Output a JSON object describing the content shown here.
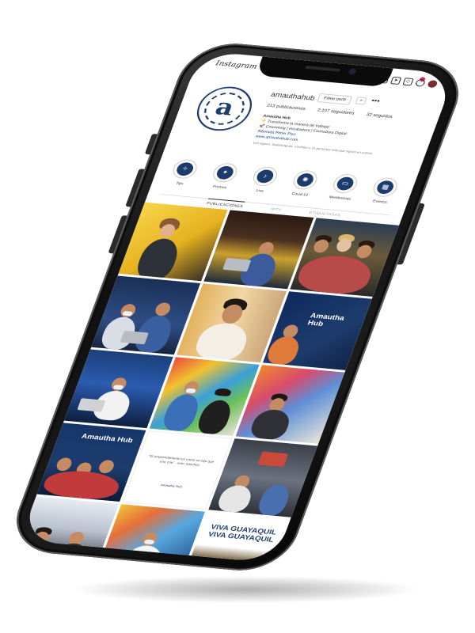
{
  "app": {
    "name": "Instagram"
  },
  "profile": {
    "logo_glyph": "a",
    "username": "amauthahub",
    "edit_label": "Editar perfil",
    "user_icon": "person-add-icon",
    "more": "•••",
    "posts": "213 publicaciones",
    "followers": "2,107 seguidores",
    "following": "32 seguidos",
    "bio_name": "Amautha Hub",
    "bio_line1": "⚡ Transforma la manera de trabajar",
    "bio_line2": "🚀 Coworking | Incubadora | Formadora Digital",
    "bio_link1": "Alborada Pimer Piso",
    "bio_link2": "www.amauthahub.com",
    "followed_by": "Les siguen: skatelenguas, rumihipo y 15 personas más que sigues en común"
  },
  "highlights": [
    {
      "label": "Tips",
      "icon": "lightbulb-icon",
      "glyph": "✧"
    },
    {
      "label": "Promos",
      "icon": "megaphone-icon",
      "glyph": "✦"
    },
    {
      "label": "Live",
      "icon": "microphone-icon",
      "glyph": "♪"
    },
    {
      "label": "Covid-19",
      "icon": "virus-icon",
      "glyph": "✺"
    },
    {
      "label": "Membresías",
      "icon": "card-icon",
      "glyph": "▭"
    },
    {
      "label": "Eventos",
      "icon": "calendar-icon",
      "glyph": "▦"
    }
  ],
  "tabs": {
    "posts": "PUBLICACIONES",
    "igtv": "IGTV",
    "tagged": "ETIQUETADAS"
  },
  "posts": [
    {
      "kind": "yellow-portrait",
      "caption": ""
    },
    {
      "kind": "cowork-dark",
      "caption": ""
    },
    {
      "kind": "three-women",
      "caption": ""
    },
    {
      "kind": "office-blue",
      "caption": ""
    },
    {
      "kind": "man-portrait",
      "caption": ""
    },
    {
      "kind": "brand-wall",
      "caption": "Amautha Hub"
    },
    {
      "kind": "masked-laptop",
      "caption": ""
    },
    {
      "kind": "colorful-wall",
      "caption": ""
    },
    {
      "kind": "show-work",
      "caption": ""
    },
    {
      "kind": "team-blue",
      "caption": "Amautha Hub"
    },
    {
      "kind": "quote-card",
      "caption": "\"El emprendimiento es como un hijo que uno cría\" - Ivan Sanchez"
    },
    {
      "kind": "meeting-room",
      "caption": ""
    },
    {
      "kind": "workshop",
      "caption": ""
    },
    {
      "kind": "laptop-man",
      "caption": ""
    },
    {
      "kind": "viva-guayaquil",
      "caption": "VIVA GUAYAQUIL VIVA GUAYAQUIL"
    }
  ],
  "quote_brand": "Amautha Hub",
  "colors": {
    "brand_blue": "#1d3c6e",
    "accent_yellow": "#f1c232"
  }
}
